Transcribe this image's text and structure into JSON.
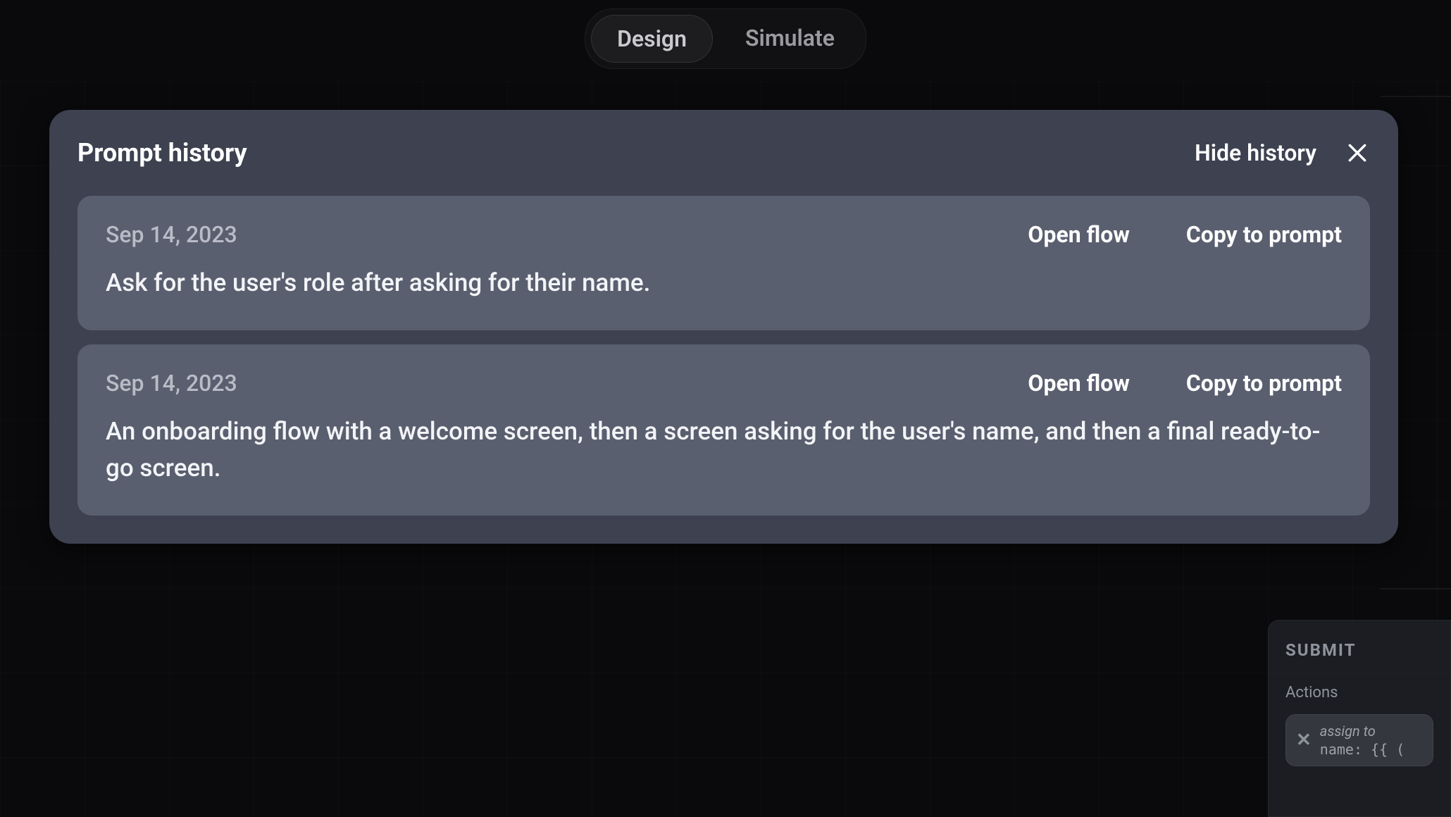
{
  "tabs": {
    "design": "Design",
    "simulate": "Simulate"
  },
  "panel": {
    "title": "Prompt history",
    "hide_label": "Hide history"
  },
  "history": [
    {
      "date": "Sep 14, 2023",
      "open_label": "Open flow",
      "copy_label": "Copy to prompt",
      "text": "Ask for the user's role after asking for their name."
    },
    {
      "date": "Sep 14, 2023",
      "open_label": "Open flow",
      "copy_label": "Copy to prompt",
      "text": "An onboarding flow with a welcome screen, then a screen asking for the user's name, and then a final ready-to-go screen."
    }
  ],
  "background_panel": {
    "title": "SUBMIT",
    "section_label": "Actions",
    "action_line1": "assign to",
    "action_line2": "name:  {{ ("
  }
}
